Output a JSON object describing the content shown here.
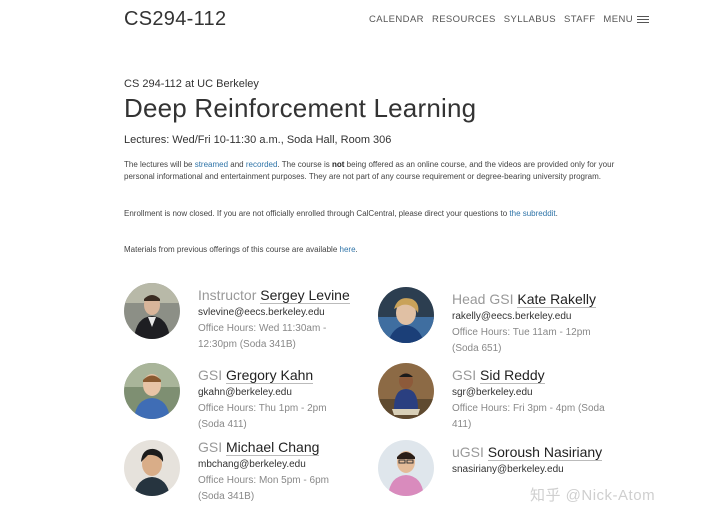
{
  "header": {
    "site_title": "CS294-112",
    "nav": [
      "CALENDAR",
      "RESOURCES",
      "SYLLABUS",
      "STAFF",
      "MENU"
    ]
  },
  "course": {
    "subtitle": "CS 294-112 at UC Berkeley",
    "title": "Deep Reinforcement Learning",
    "lectures": "Lectures: Wed/Fri 10-11:30 a.m., Soda Hall, Room 306"
  },
  "paragraphs": {
    "p1": {
      "t1": "The lectures will be ",
      "link1": "streamed",
      "t2": " and ",
      "link2": "recorded",
      "t3": ". The course is ",
      "bold": "not",
      "t4": " being offered as an online course, and the videos are provided only for your personal informational and entertainment purposes. They are not part of any course requirement or degree-bearing university program."
    },
    "p2": {
      "t1": "Enrollment is now closed. If you are not officially enrolled through CalCentral, please direct your questions to ",
      "link": "the subreddit",
      "t2": "."
    },
    "p3": {
      "t1": "Materials from previous offerings of this course are available ",
      "link": "here",
      "t2": "."
    }
  },
  "staff": [
    {
      "role": "Instructor",
      "name": "Sergey Levine",
      "email": "svlevine@eecs.berkeley.edu",
      "hours": "Office Hours: Wed 11:30am - 12:30pm (Soda 341B)"
    },
    {
      "role": "Head GSI",
      "name": "Kate Rakelly",
      "email": "rakelly@eecs.berkeley.edu",
      "hours": "Office Hours: Tue 11am - 12pm (Soda 651)"
    },
    {
      "role": "GSI",
      "name": "Gregory Kahn",
      "email": "gkahn@berkeley.edu",
      "hours": "Office Hours: Thu 1pm - 2pm (Soda 411)"
    },
    {
      "role": "GSI",
      "name": "Sid Reddy",
      "email": "sgr@berkeley.edu",
      "hours": "Office Hours: Fri 3pm - 4pm (Soda 411)"
    },
    {
      "role": "GSI",
      "name": "Michael Chang",
      "email": "mbchang@berkeley.edu",
      "hours": "Office Hours: Mon 5pm - 6pm (Soda 341B)"
    },
    {
      "role": "uGSI",
      "name": "Soroush Nasiriany",
      "email": "snasiriany@berkeley.edu",
      "hours": ""
    }
  ],
  "watermark": "知乎 @Nick-Atom",
  "colors": {
    "link": "#2f74a8",
    "text": "#333333",
    "role": "#999999"
  }
}
